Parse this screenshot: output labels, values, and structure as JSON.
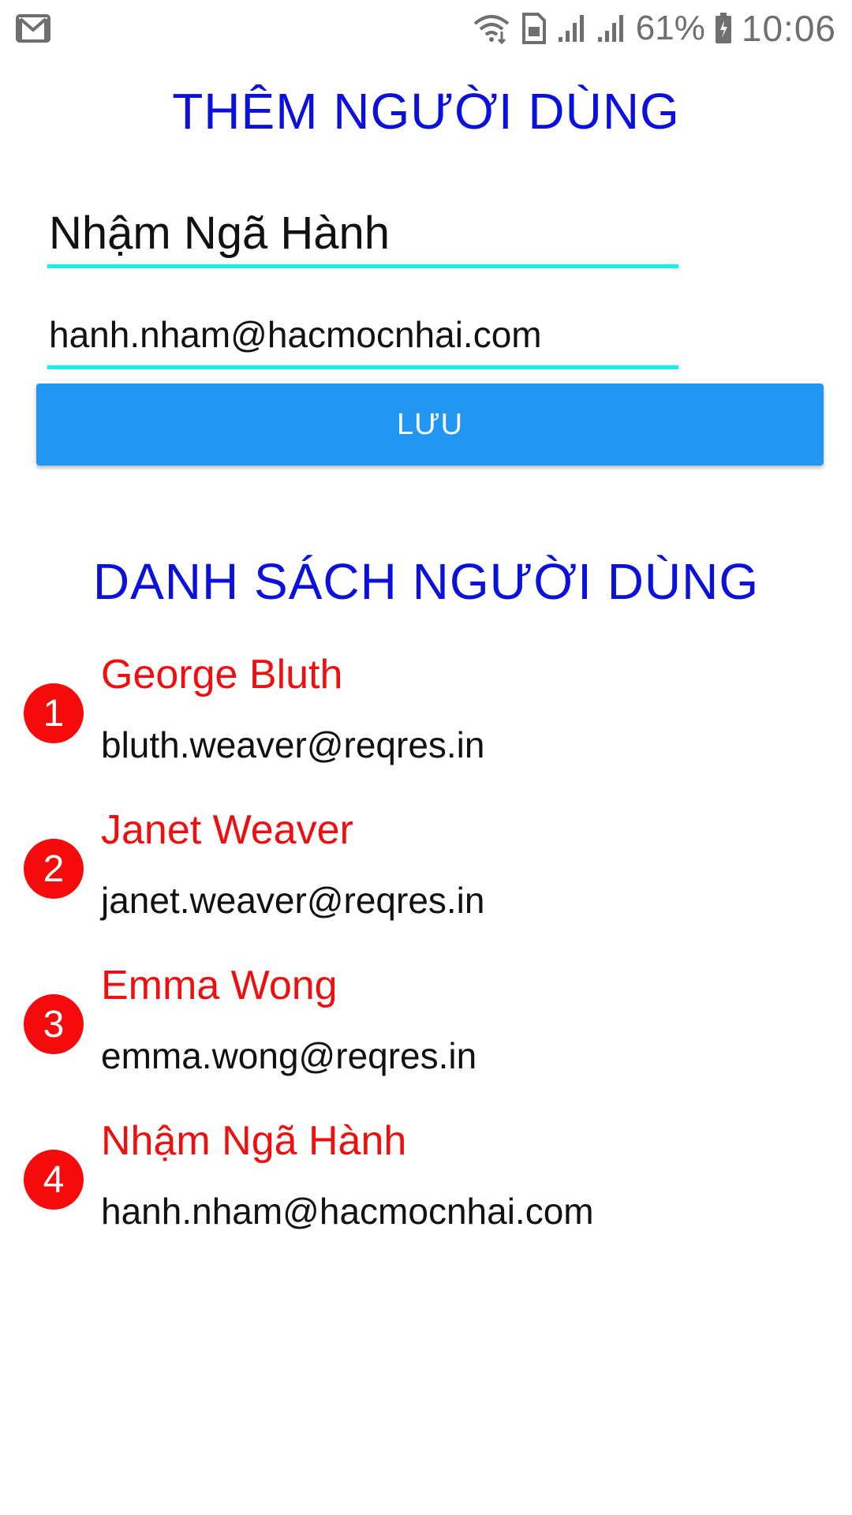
{
  "status_bar": {
    "icons": [
      "gmail-icon",
      "wifi-icon",
      "sim-icon",
      "signal-icon",
      "signal-icon",
      "battery-icon"
    ],
    "battery": "61%",
    "time": "10:06"
  },
  "form": {
    "title": "THÊM NGƯỜI DÙNG",
    "name_value": "Nhậm Ngã Hành",
    "email_value": "hanh.nham@hacmocnhai.com",
    "save_label": "LƯU",
    "accent_color": "#12f0f0",
    "button_color": "#2196f3"
  },
  "list": {
    "title": "DANH SÁCH NGƯỜI DÙNG",
    "title_color": "#0b10dc",
    "name_color": "#ee1010",
    "items": [
      {
        "index": "1",
        "name": "George Bluth",
        "email": "bluth.weaver@reqres.in"
      },
      {
        "index": "2",
        "name": "Janet Weaver",
        "email": "janet.weaver@reqres.in"
      },
      {
        "index": "3",
        "name": "Emma Wong",
        "email": "emma.wong@reqres.in"
      },
      {
        "index": "4",
        "name": "Nhậm Ngã Hành",
        "email": "hanh.nham@hacmocnhai.com"
      }
    ]
  }
}
